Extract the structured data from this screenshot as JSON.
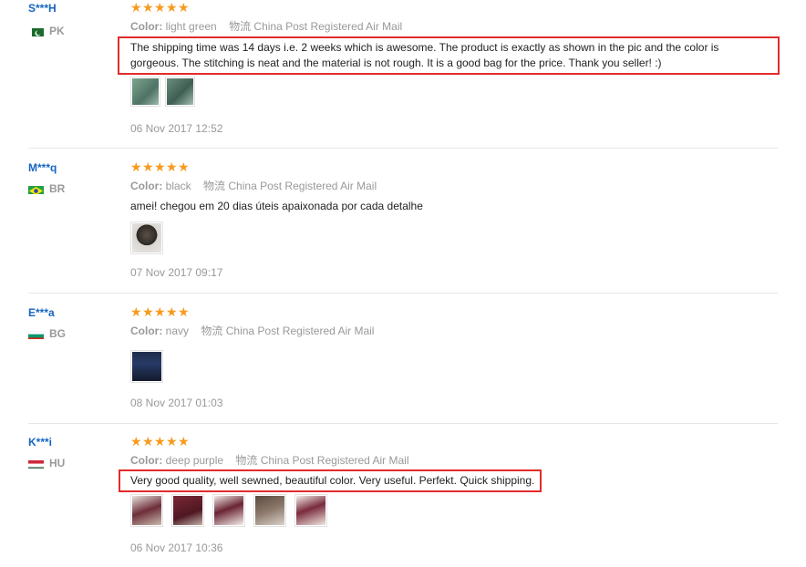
{
  "reviews": [
    {
      "username": "S***H",
      "country": "PK",
      "flag": "pk-flag-icon",
      "rating": 5,
      "color_label": "Color:",
      "color": "light green",
      "shipping_label": "物流",
      "shipping": "China Post Registered Air Mail",
      "text": "The shipping time was 14 days i.e. 2 weeks which is awesome. The product is exactly as shown in the pic and the color is gorgeous. The stitching is neat and the material is not rough. It is a good bag for the price. Thank you seller! :)",
      "highlighted": true,
      "photos": 2,
      "date": "06 Nov 2017 12:52"
    },
    {
      "username": "M***q",
      "country": "BR",
      "flag": "br-flag-icon",
      "rating": 5,
      "color_label": "Color:",
      "color": "black",
      "shipping_label": "物流",
      "shipping": "China Post Registered Air Mail",
      "text": "amei! chegou em 20 dias úteis apaixonada por cada detalhe",
      "highlighted": false,
      "photos": 1,
      "date": "07 Nov 2017 09:17"
    },
    {
      "username": "E***a",
      "country": "BG",
      "flag": "bg-flag-icon",
      "rating": 5,
      "color_label": "Color:",
      "color": "navy",
      "shipping_label": "物流",
      "shipping": "China Post Registered Air Mail",
      "text": "",
      "highlighted": false,
      "photos": 1,
      "date": "08 Nov 2017 01:03"
    },
    {
      "username": "K***i",
      "country": "HU",
      "flag": "hu-flag-icon",
      "rating": 5,
      "color_label": "Color:",
      "color": "deep purple",
      "shipping_label": "物流",
      "shipping": "China Post Registered Air Mail",
      "text": "Very good quality, well sewned, beautiful color. Very useful. Perfekt. Quick shipping.",
      "highlighted": true,
      "photos": 5,
      "date": "06 Nov 2017 10:36"
    }
  ],
  "colors": {
    "username": "#1565c0",
    "star": "#f79a1e",
    "highlight_border": "#e32b2b",
    "muted": "#999999"
  }
}
